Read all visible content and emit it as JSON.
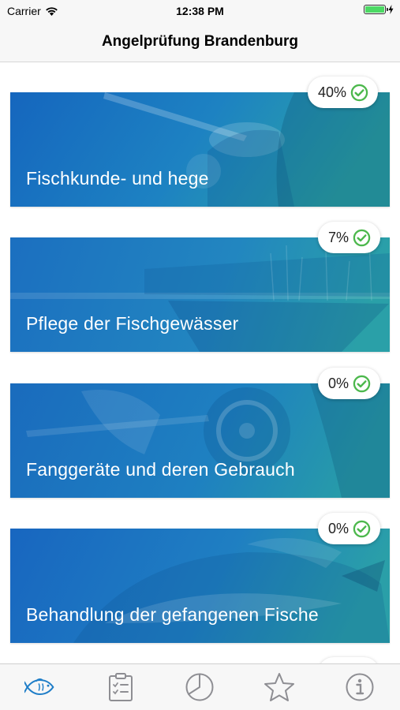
{
  "status_bar": {
    "carrier": "Carrier",
    "time": "12:38 PM"
  },
  "nav": {
    "title": "Angelprüfung Brandenburg"
  },
  "topics": [
    {
      "label": "Fischkunde- und hege",
      "progress": "40%",
      "progress_value": 40,
      "icon": "check-circle-icon"
    },
    {
      "label": "Pflege der Fischgewässer",
      "progress": "7%",
      "progress_value": 7,
      "icon": "check-circle-icon"
    },
    {
      "label": "Fanggeräte und deren Gebrauch",
      "progress": "0%",
      "progress_value": 0,
      "icon": "check-circle-icon"
    },
    {
      "label": "Behandlung der gefangenen Fische",
      "progress": "0%",
      "progress_value": 0,
      "icon": "check-circle-icon"
    }
  ],
  "tabs": [
    {
      "icon": "fish-icon",
      "active": true
    },
    {
      "icon": "clipboard-checklist-icon",
      "active": false
    },
    {
      "icon": "pie-chart-icon",
      "active": false
    },
    {
      "icon": "star-icon",
      "active": false
    },
    {
      "icon": "info-icon",
      "active": false
    }
  ],
  "colors": {
    "accent": "#1f7ec8",
    "card_blue": "#1a72c4",
    "card_teal": "#2aa3a8",
    "check_green": "#4cb84c",
    "tab_inactive": "#8e8e93"
  }
}
